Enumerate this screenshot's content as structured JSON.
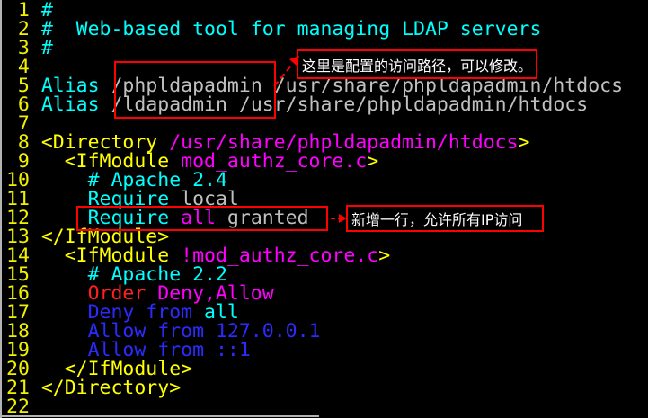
{
  "palette": {
    "background": "#000000",
    "border_gray": "#b3b3b3",
    "line_number": "#f0f000",
    "cyan": "#00ffff",
    "yellow": "#ffff00",
    "magenta": "#ff00ff",
    "gray": "#c0c0c0",
    "red": "#ff2020",
    "blue": "#2b2bff",
    "box_red": "#ff0000",
    "white": "#ffffff"
  },
  "editor": {
    "lines": [
      {
        "num": "1",
        "tokens": [
          {
            "text": "#",
            "color": "cyan"
          }
        ]
      },
      {
        "num": "2",
        "tokens": [
          {
            "text": "#  Web-based tool for managing LDAP servers",
            "color": "cyan"
          }
        ]
      },
      {
        "num": "3",
        "tokens": [
          {
            "text": "#",
            "color": "cyan"
          }
        ]
      },
      {
        "num": "4",
        "tokens": []
      },
      {
        "num": "5",
        "tokens": [
          {
            "text": "Alias",
            "color": "cyan"
          },
          {
            "text": " /phpldapadmin /usr/share/phpldapadmin/htdocs",
            "color": "gray"
          }
        ]
      },
      {
        "num": "6",
        "tokens": [
          {
            "text": "Alias",
            "color": "cyan"
          },
          {
            "text": " /ldapadmin /usr/share/phpldapadmin/htdocs",
            "color": "gray"
          }
        ]
      },
      {
        "num": "7",
        "tokens": []
      },
      {
        "num": "8",
        "tokens": [
          {
            "text": "<Directory",
            "color": "yellow"
          },
          {
            "text": " /usr/share/phpldapadmin/htdocs",
            "color": "magenta"
          },
          {
            "text": ">",
            "color": "yellow"
          }
        ]
      },
      {
        "num": "9",
        "tokens": [
          {
            "text": "  <IfModule",
            "color": "yellow"
          },
          {
            "text": " mod_authz_core.c",
            "color": "magenta"
          },
          {
            "text": ">",
            "color": "yellow"
          }
        ]
      },
      {
        "num": "10",
        "tokens": [
          {
            "text": "    # Apache 2.4",
            "color": "cyan"
          }
        ]
      },
      {
        "num": "11",
        "tokens": [
          {
            "text": "    Require",
            "color": "cyan"
          },
          {
            "text": " local",
            "color": "gray"
          }
        ]
      },
      {
        "num": "12",
        "tokens": [
          {
            "text": "    Require",
            "color": "cyan"
          },
          {
            "text": " all",
            "color": "magenta"
          },
          {
            "text": " granted",
            "color": "gray"
          }
        ]
      },
      {
        "num": "13",
        "tokens": [
          {
            "text": "</IfModule>",
            "color": "yellow"
          }
        ]
      },
      {
        "num": "14",
        "tokens": [
          {
            "text": "  <IfModule",
            "color": "yellow"
          },
          {
            "text": " !mod_authz_core.c",
            "color": "magenta"
          },
          {
            "text": ">",
            "color": "yellow"
          }
        ]
      },
      {
        "num": "15",
        "tokens": [
          {
            "text": "    # Apache 2.2",
            "color": "cyan"
          }
        ]
      },
      {
        "num": "16",
        "tokens": [
          {
            "text": "    Order",
            "color": "red"
          },
          {
            "text": " Deny,Allow",
            "color": "magenta"
          }
        ]
      },
      {
        "num": "17",
        "tokens": [
          {
            "text": "    Deny from",
            "color": "blue"
          },
          {
            "text": " all",
            "color": "cyan"
          }
        ]
      },
      {
        "num": "18",
        "tokens": [
          {
            "text": "    Allow from 127.0.0.1",
            "color": "blue"
          }
        ]
      },
      {
        "num": "19",
        "tokens": [
          {
            "text": "    Allow from ::1",
            "color": "blue"
          }
        ]
      },
      {
        "num": "20",
        "tokens": [
          {
            "text": "  </IfModule>",
            "color": "yellow"
          }
        ]
      },
      {
        "num": "21",
        "tokens": [
          {
            "text": "</Directory>",
            "color": "yellow"
          }
        ]
      },
      {
        "num": "22",
        "tokens": []
      }
    ]
  },
  "annotations": {
    "path_note": "这里是配置的访问路径，可以修改。",
    "require_note": "新增一行，允许所有IP访问"
  }
}
